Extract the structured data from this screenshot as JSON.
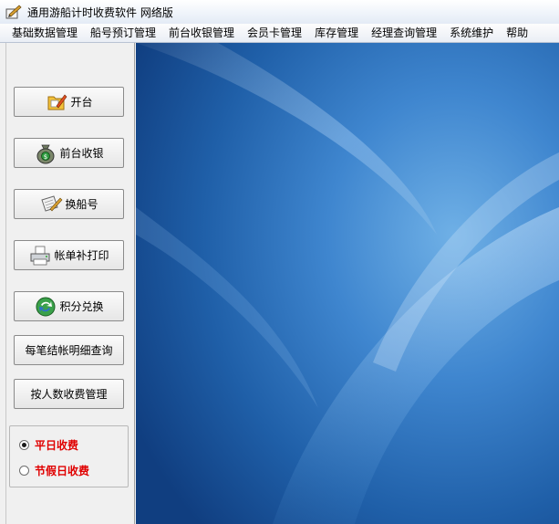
{
  "window": {
    "title": "通用游船计时收费软件  网络版"
  },
  "menu": [
    {
      "label": "基础数据管理"
    },
    {
      "label": "船号预订管理"
    },
    {
      "label": "前台收银管理"
    },
    {
      "label": "会员卡管理"
    },
    {
      "label": "库存管理"
    },
    {
      "label": "经理查询管理"
    },
    {
      "label": "系统维护"
    },
    {
      "label": "帮助"
    }
  ],
  "sidebar": {
    "buttons": [
      {
        "label": "开台",
        "icon": "folder-edit-icon"
      },
      {
        "label": "前台收银",
        "icon": "money-bag-icon"
      },
      {
        "label": "换船号",
        "icon": "scroll-pen-icon"
      },
      {
        "label": "帐单补打印",
        "icon": "printer-icon"
      },
      {
        "label": "积分兑换",
        "icon": "exchange-icon"
      },
      {
        "label": "每笔结帐明细查询",
        "icon": ""
      },
      {
        "label": "按人数收费管理",
        "icon": ""
      }
    ],
    "rate_options": [
      {
        "label": "平日收费",
        "checked": true
      },
      {
        "label": "节假日收费",
        "checked": false
      }
    ]
  },
  "colors": {
    "accent_red": "#e00000",
    "desktop_blue": "#1f5fa8"
  }
}
